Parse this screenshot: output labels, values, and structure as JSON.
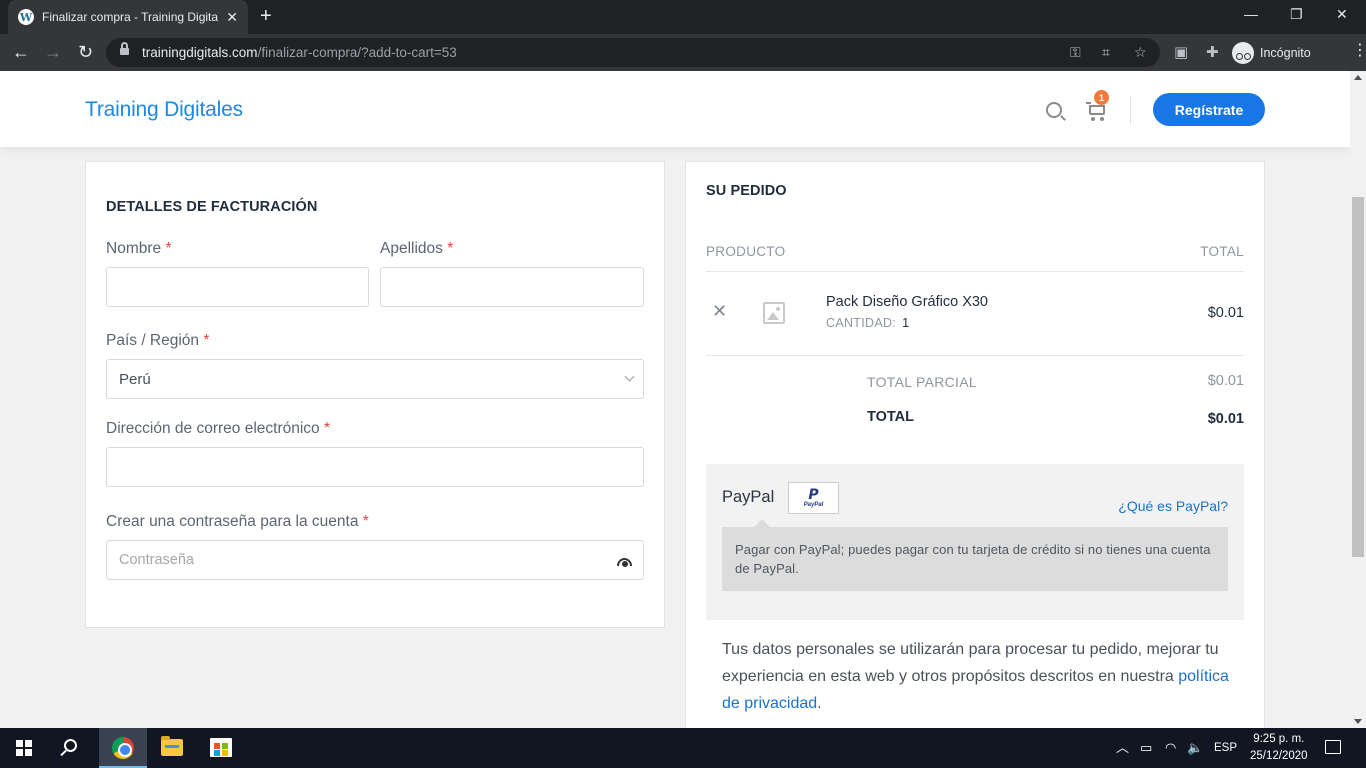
{
  "browser": {
    "tab_title": "Finalizar compra - Training Digita",
    "url_domain": "trainingdigitals.com",
    "url_path": "/finalizar-compra/?add-to-cart=53",
    "incognito_label": "Incógnito",
    "icons": [
      "wordpress-icon",
      "close-icon",
      "plus-icon",
      "back-icon",
      "forward-icon",
      "reload-icon",
      "lock-icon",
      "key-icon",
      "translate-icon",
      "star-icon",
      "cast-icon",
      "extensions-icon",
      "incognito-icon",
      "menu-icon"
    ]
  },
  "site": {
    "logo": "Training Digitales",
    "cart_count": "1",
    "register_label": "Regístrate"
  },
  "billing": {
    "title": "DETALLES DE FACTURACIÓN",
    "first_name_label": "Nombre",
    "last_name_label": "Apellidos",
    "required_mark": "*",
    "first_name_value": "",
    "last_name_value": "",
    "country_label": "País / Región",
    "country_value": "Perú",
    "email_label": "Dirección de correo electrónico",
    "email_value": "",
    "password_label": "Crear una contraseña para la cuenta",
    "password_placeholder": "Contraseña"
  },
  "order": {
    "title": "SU PEDIDO",
    "col_product": "PRODUCTO",
    "col_total": "TOTAL",
    "items": [
      {
        "name": "Pack Diseño Gráfico X30",
        "qty_label": "CANTIDAD:",
        "qty": "1",
        "price": "$0.01"
      }
    ],
    "subtotal_label": "TOTAL PARCIAL",
    "subtotal_value": "$0.01",
    "total_label": "TOTAL",
    "total_value": "$0.01"
  },
  "payment": {
    "method": "PayPal",
    "logo_text": "PayPal",
    "what_is": "¿Qué es PayPal?",
    "description": "Pagar con PayPal; puedes pagar con tu tarjeta de crédito si no tienes una cuenta de PayPal."
  },
  "privacy": {
    "text_before": "Tus datos personales se utilizarán para procesar tu pedido, mejorar tu experiencia en esta web y otros propósitos descritos en nuestra ",
    "link": "política de privacidad",
    "text_after": "."
  },
  "taskbar": {
    "language": "ESP",
    "time": "9:25 p. m.",
    "date": "25/12/2020"
  },
  "colors": {
    "brand_blue": "#1976e5",
    "logo_blue": "#1e88e5",
    "badge_orange": "#f5793a",
    "required_red": "#e04444"
  }
}
